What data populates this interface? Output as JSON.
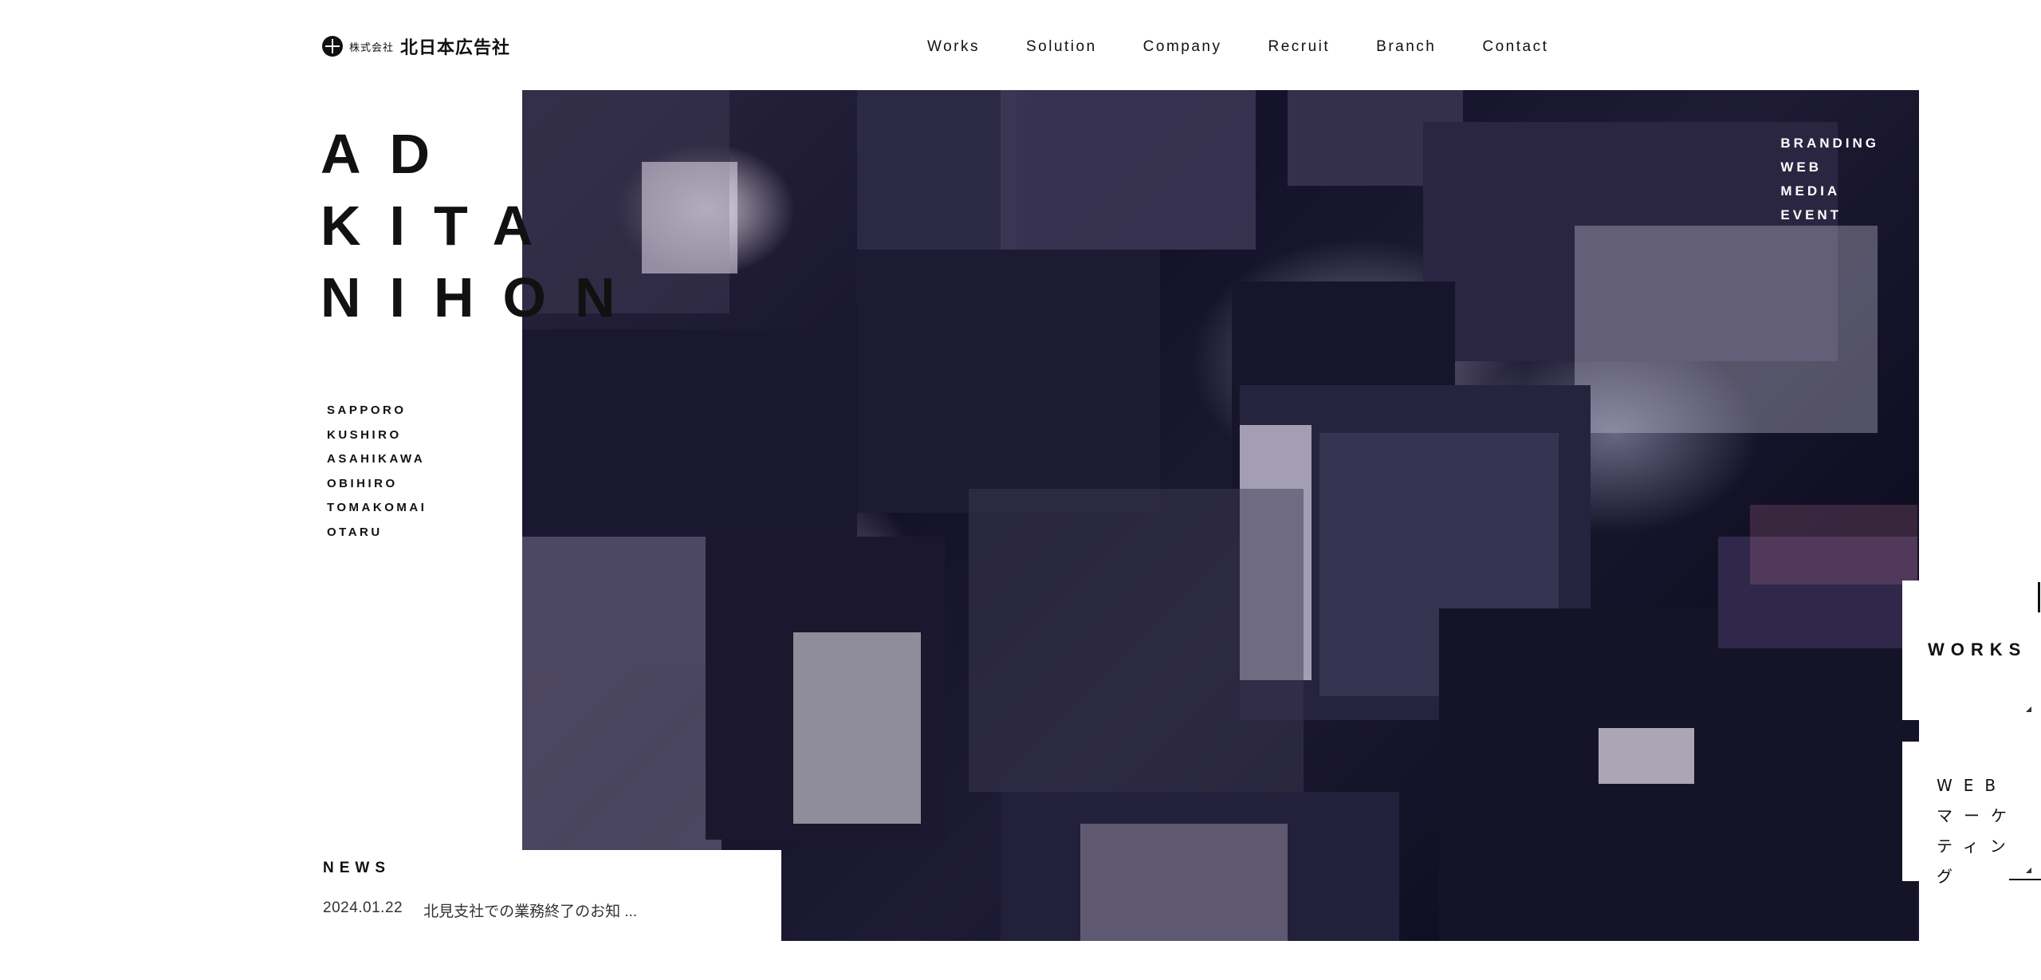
{
  "header": {
    "logo_small": "株式会社",
    "logo_name": "北日本広告社",
    "nav": [
      "Works",
      "Solution",
      "Company",
      "Recruit",
      "Branch",
      "Contact"
    ]
  },
  "hero": {
    "title_lines": [
      "AD",
      "KITA",
      "NIHON"
    ],
    "cities": [
      "SAPPORO",
      "KUSHIRO",
      "ASAHIKAWA",
      "OBIHIRO",
      "TOMAKOMAI",
      "OTARU"
    ],
    "services": [
      "BRANDING",
      "WEB",
      "MEDIA",
      "EVENT"
    ]
  },
  "news": {
    "label": "NEWS",
    "items": [
      {
        "date": "2024.01.22",
        "title": "北見支社での業務終了のお知 ..."
      }
    ]
  },
  "side_links": {
    "works": "WORKS",
    "web_marketing": "WEBマーケティング"
  },
  "colors": {
    "background": "#ffffff",
    "text": "#111111",
    "hero_night": "#14122a"
  }
}
